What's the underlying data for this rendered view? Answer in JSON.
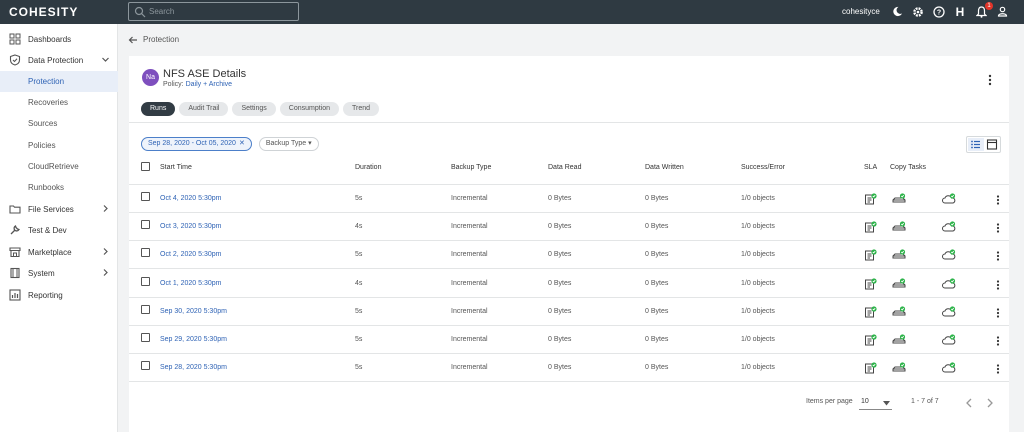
{
  "topbar": {
    "logo": "COHESITY",
    "search_placeholder": "Search",
    "username": "cohesityce",
    "help_letter": "H",
    "notification_count": "1",
    "icons": [
      "moon-icon",
      "gear-icon",
      "help-circle-icon",
      "h-icon",
      "bell-icon",
      "user-icon"
    ]
  },
  "sidebar": {
    "items": [
      {
        "label": "Dashboards",
        "icon": "grid-icon"
      },
      {
        "label": "Data Protection",
        "icon": "shield-icon",
        "expanded": true
      },
      {
        "label": "Protection",
        "sub": true,
        "active": true
      },
      {
        "label": "Recoveries",
        "sub": true
      },
      {
        "label": "Sources",
        "sub": true
      },
      {
        "label": "Policies",
        "sub": true
      },
      {
        "label": "CloudRetrieve",
        "sub": true
      },
      {
        "label": "Runbooks",
        "sub": true
      },
      {
        "label": "File Services",
        "icon": "folder-icon",
        "has_chevron": true
      },
      {
        "label": "Test & Dev",
        "icon": "wrench-icon"
      },
      {
        "label": "Marketplace",
        "icon": "store-icon",
        "has_chevron": true
      },
      {
        "label": "System",
        "icon": "server-icon",
        "has_chevron": true
      },
      {
        "label": "Reporting",
        "icon": "chart-icon"
      }
    ]
  },
  "breadcrumb": {
    "back_label": "Protection"
  },
  "details": {
    "avatar_initials": "Na",
    "title": "NFS ASE Details",
    "policy_prefix": "Policy:",
    "policy_name": "Daily + Archive",
    "tabs": [
      "Runs",
      "Audit Trail",
      "Settings",
      "Consumption",
      "Trend"
    ],
    "active_tab": "Runs"
  },
  "filters": {
    "date_range": "Sep 28, 2020 - Oct 05, 2020",
    "backup_type_label": "Backup Type"
  },
  "table": {
    "columns": [
      "Start Time",
      "Duration",
      "Backup Type",
      "Data Read",
      "Data Written",
      "Success/Error",
      "SLA",
      "Copy Tasks"
    ],
    "rows": [
      {
        "start": "Oct 4, 2020 5:30pm",
        "duration": "5s",
        "type": "Incremental",
        "read": "0 Bytes",
        "written": "0 Bytes",
        "status": "1/0 objects"
      },
      {
        "start": "Oct 3, 2020 5:30pm",
        "duration": "4s",
        "type": "Incremental",
        "read": "0 Bytes",
        "written": "0 Bytes",
        "status": "1/0 objects"
      },
      {
        "start": "Oct 2, 2020 5:30pm",
        "duration": "5s",
        "type": "Incremental",
        "read": "0 Bytes",
        "written": "0 Bytes",
        "status": "1/0 objects"
      },
      {
        "start": "Oct 1, 2020 5:30pm",
        "duration": "4s",
        "type": "Incremental",
        "read": "0 Bytes",
        "written": "0 Bytes",
        "status": "1/0 objects"
      },
      {
        "start": "Sep 30, 2020 5:30pm",
        "duration": "5s",
        "type": "Incremental",
        "read": "0 Bytes",
        "written": "0 Bytes",
        "status": "1/0 objects"
      },
      {
        "start": "Sep 29, 2020 5:30pm",
        "duration": "5s",
        "type": "Incremental",
        "read": "0 Bytes",
        "written": "0 Bytes",
        "status": "1/0 objects"
      },
      {
        "start": "Sep 28, 2020 5:30pm",
        "duration": "5s",
        "type": "Incremental",
        "read": "0 Bytes",
        "written": "0 Bytes",
        "status": "1/0 objects"
      }
    ]
  },
  "pagination": {
    "items_per_page_label": "Items per page",
    "items_per_page_value": "10",
    "range_label": "1 - 7 of 7"
  },
  "colors": {
    "topbar": "#2f3a42",
    "accent": "#2f63b5",
    "success": "#2db34a",
    "avatar": "#7e4fbe"
  }
}
